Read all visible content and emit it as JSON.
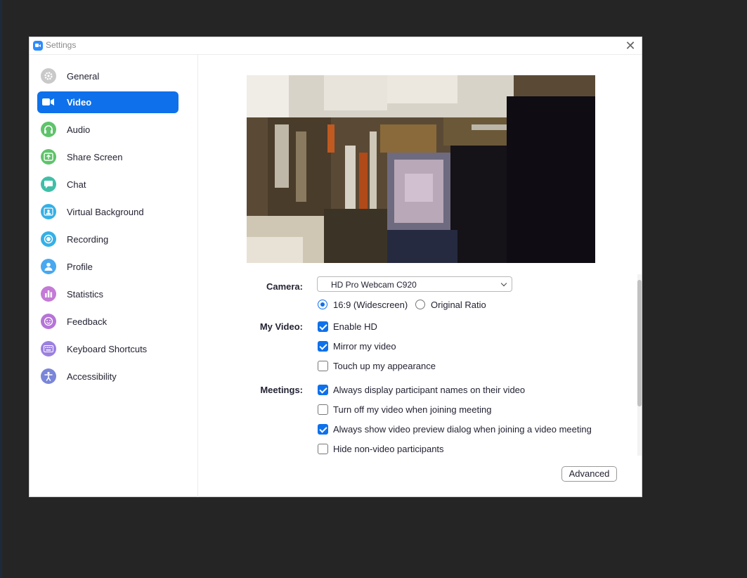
{
  "window": {
    "title": "Settings"
  },
  "sidebar": {
    "items": [
      {
        "label": "General",
        "icon": "gear-icon",
        "color": "#bdbdbd",
        "active": false
      },
      {
        "label": "Video",
        "icon": "video-camera-icon",
        "color": "#0e71eb",
        "active": true
      },
      {
        "label": "Audio",
        "icon": "headphones-icon",
        "color": "#5fc36b",
        "active": false
      },
      {
        "label": "Share Screen",
        "icon": "share-screen-icon",
        "color": "#5fc36b",
        "active": false
      },
      {
        "label": "Chat",
        "icon": "chat-bubble-icon",
        "color": "#3fbfa7",
        "active": false
      },
      {
        "label": "Virtual Background",
        "icon": "virtual-background-icon",
        "color": "#35b0e6",
        "active": false
      },
      {
        "label": "Recording",
        "icon": "record-icon",
        "color": "#35b0e6",
        "active": false
      },
      {
        "label": "Profile",
        "icon": "person-icon",
        "color": "#49a8f0",
        "active": false
      },
      {
        "label": "Statistics",
        "icon": "bar-chart-icon",
        "color": "#c47ad6",
        "active": false
      },
      {
        "label": "Feedback",
        "icon": "smiley-icon",
        "color": "#b574d8",
        "active": false
      },
      {
        "label": "Keyboard Shortcuts",
        "icon": "keyboard-icon",
        "color": "#9c80e0",
        "active": false
      },
      {
        "label": "Accessibility",
        "icon": "accessibility-icon",
        "color": "#7a86d8",
        "active": false
      }
    ]
  },
  "video": {
    "camera_label": "Camera:",
    "camera_value": "HD Pro Webcam C920",
    "ratio_widescreen": "16:9 (Widescreen)",
    "ratio_original": "Original Ratio",
    "ratio_selected": "16:9 (Widescreen)",
    "my_video_label": "My Video:",
    "my_video_options": [
      {
        "label": "Enable HD",
        "checked": true
      },
      {
        "label": "Mirror my video",
        "checked": true
      },
      {
        "label": "Touch up my appearance",
        "checked": false
      }
    ],
    "meetings_label": "Meetings:",
    "meetings_options": [
      {
        "label": "Always display participant names on their video",
        "checked": true
      },
      {
        "label": "Turn off my video when joining meeting",
        "checked": false
      },
      {
        "label": "Always show video preview dialog when joining a video meeting",
        "checked": true
      },
      {
        "label": "Hide non-video participants",
        "checked": false
      }
    ],
    "advanced_label": "Advanced"
  },
  "colors": {
    "accent": "#0e71eb",
    "desktop": "#252525"
  }
}
